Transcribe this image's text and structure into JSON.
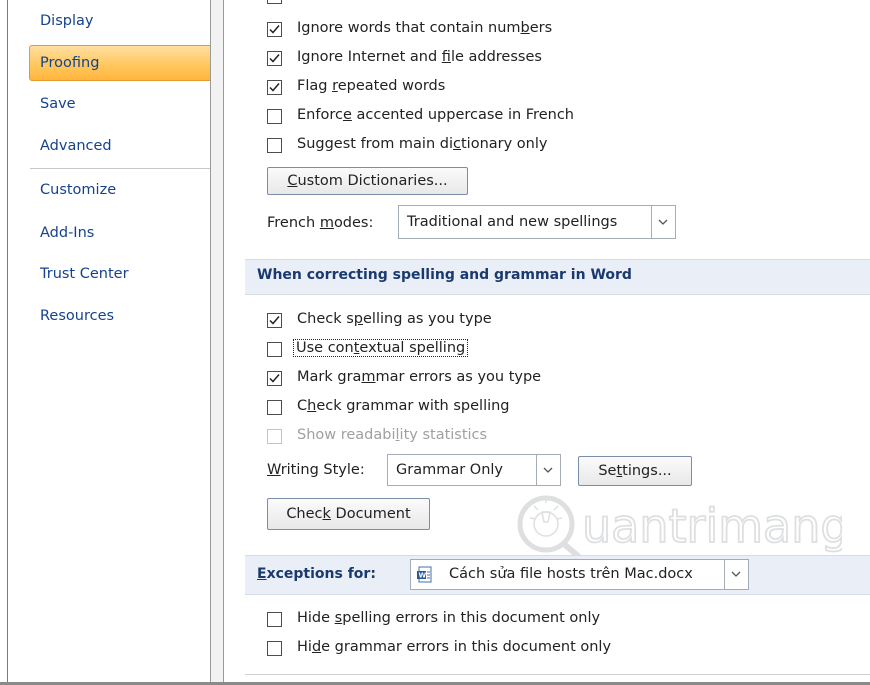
{
  "sidebar": {
    "items": [
      {
        "label": "Display"
      },
      {
        "label": "Proofing",
        "selected": true
      },
      {
        "label": "Save"
      },
      {
        "label": "Advanced"
      },
      {
        "label": "Customize"
      },
      {
        "label": "Add-Ins"
      },
      {
        "label": "Trust Center"
      },
      {
        "label": "Resources"
      }
    ]
  },
  "office_options": {
    "ignore_numbers": {
      "pre": "Ignore words that contain num",
      "key": "b",
      "post": "ers",
      "checked": true
    },
    "ignore_internet": {
      "pre": "Ignore Internet and ",
      "key": "f",
      "post": "ile addresses",
      "checked": true
    },
    "flag_repeated": {
      "pre": "Flag ",
      "key": "r",
      "post": "epeated words",
      "checked": true
    },
    "enforce_accented": {
      "pre": "Enforc",
      "key": "e",
      "post": " accented uppercase in French",
      "checked": false
    },
    "suggest_main": {
      "pre": "Suggest from main di",
      "key": "c",
      "post": "tionary only",
      "checked": false
    },
    "custom_dictionaries": {
      "pre": "",
      "key": "C",
      "post": "ustom Dictionaries..."
    },
    "french_modes": {
      "pre": "French ",
      "key": "m",
      "post": "odes:",
      "value": "Traditional and new spellings"
    }
  },
  "word_section": {
    "title": "When correcting spelling and grammar in Word",
    "check_spelling": {
      "pre": "Check s",
      "key": "p",
      "post": "elling as you type",
      "checked": true
    },
    "contextual": {
      "pre": "Use con",
      "key": "t",
      "post": "extual spelling",
      "checked": false
    },
    "mark_grammar": {
      "pre": "Mark gra",
      "key": "m",
      "post": "mar errors as you type",
      "checked": true
    },
    "check_grammar": {
      "pre": "C",
      "key": "h",
      "post": "eck grammar with spelling",
      "checked": false
    },
    "readability": {
      "pre": "Show readabi",
      "key": "l",
      "post": "ity statistics",
      "checked": false,
      "disabled": true
    },
    "writing_style": {
      "pre": "",
      "key": "W",
      "post": "riting Style:",
      "value": "Grammar Only"
    },
    "settings_button": {
      "pre": "Se",
      "key": "t",
      "post": "tings..."
    },
    "check_document": {
      "pre": "Chec",
      "key": "k",
      "post": " Document"
    }
  },
  "exceptions": {
    "label_pre": "",
    "label_key": "E",
    "label_post": "xceptions for:",
    "document": "Cách sửa file hosts trên Mac.docx",
    "hide_spelling": {
      "pre": "Hide ",
      "key": "s",
      "post": "pelling errors in this document only",
      "checked": false
    },
    "hide_grammar": {
      "pre": "Hi",
      "key": "d",
      "post": "e grammar errors in this document only",
      "checked": false
    }
  },
  "watermark": {
    "text": "uantrimang"
  },
  "colors": {
    "accent": "#ffc860",
    "nav_text": "#15428b",
    "section_bg": "#eaeef6"
  }
}
